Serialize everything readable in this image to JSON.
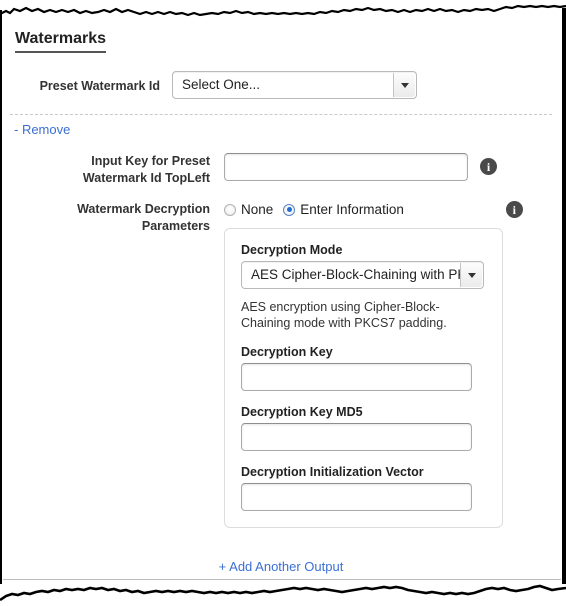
{
  "section": {
    "title": "Watermarks"
  },
  "preset": {
    "label": "Preset Watermark Id",
    "select_value": "Select One...",
    "caret_icon": "chevron-down-icon"
  },
  "remove_link": {
    "label": "- Remove"
  },
  "input_key": {
    "label_line1": "Input Key for Preset",
    "label_line2": "Watermark Id TopLeft",
    "value": "",
    "placeholder": "",
    "info_icon": "info-icon"
  },
  "decryption_params": {
    "label_line1": "Watermark Decryption",
    "label_line2": "Parameters",
    "info_icon": "info-icon",
    "radios": [
      {
        "label": "None",
        "checked": false
      },
      {
        "label": "Enter Information",
        "checked": true
      }
    ],
    "panel": {
      "mode": {
        "label": "Decryption Mode",
        "value": "AES Cipher-Block-Chaining with PKCS",
        "caret_icon": "chevron-down-icon",
        "help": "AES encryption using Cipher-Block-Chaining mode with PKCS7 padding."
      },
      "key": {
        "label": "Decryption Key",
        "value": "",
        "placeholder": ""
      },
      "key_md5": {
        "label": "Decryption Key MD5",
        "value": "",
        "placeholder": ""
      },
      "iv": {
        "label": "Decryption Initialization Vector",
        "value": "",
        "placeholder": ""
      }
    }
  },
  "footer": {
    "add_output_label": "+ Add Another Output"
  },
  "colors": {
    "link": "#3b6fd4",
    "radio_checked": "#1f6fd0",
    "info_bg": "#4a4a4a",
    "panel_border": "#dcdcdc"
  }
}
